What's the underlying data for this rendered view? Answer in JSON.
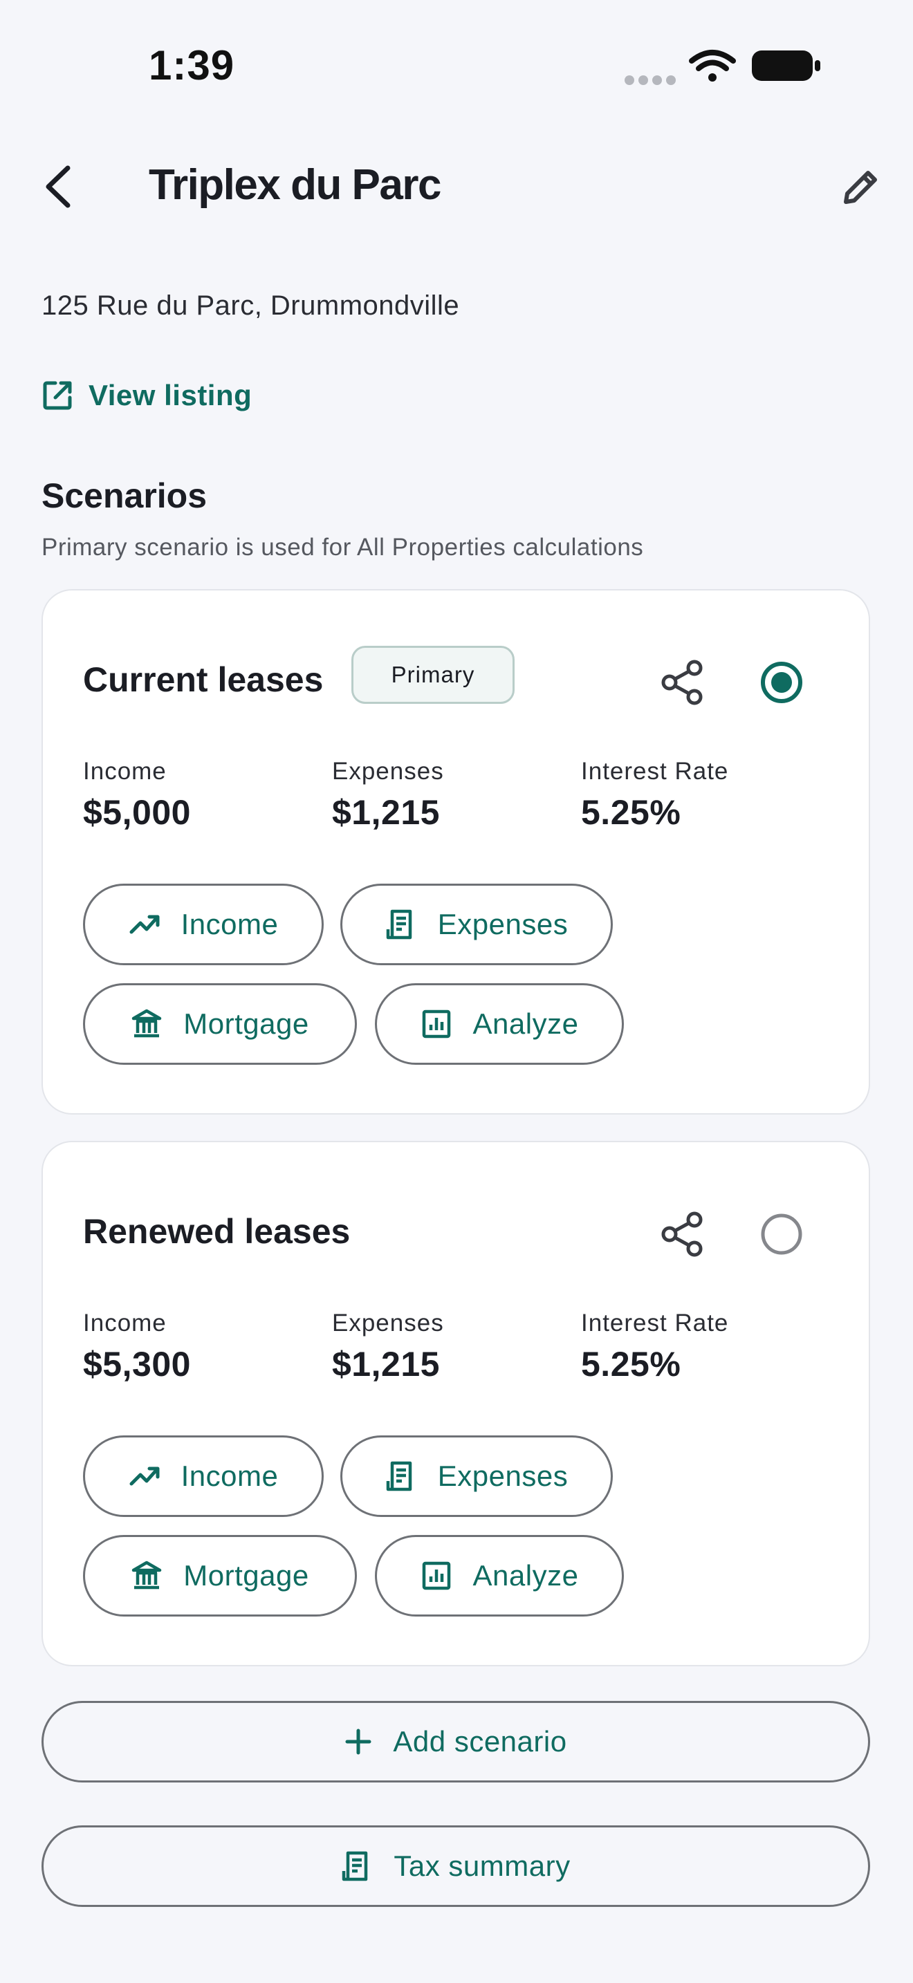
{
  "status_bar": {
    "time": "1:39",
    "icons": [
      "signal-dots-icon",
      "wifi-icon",
      "battery-icon"
    ]
  },
  "header": {
    "title": "Triplex du Parc",
    "back_icon": "chevron-left-icon",
    "edit_icon": "pencil-icon"
  },
  "property": {
    "address": "125 Rue du Parc, Drummondville",
    "view_listing_label": "View listing"
  },
  "scenarios_section": {
    "title": "Scenarios",
    "subtitle": "Primary scenario is used for All Properties calculations"
  },
  "scenarios": [
    {
      "name": "Current leases",
      "badge": "Primary",
      "selected": true,
      "metrics": [
        {
          "label": "Income",
          "value": "$5,000"
        },
        {
          "label": "Expenses",
          "value": "$1,215"
        },
        {
          "label": "Interest Rate",
          "value": "5.25%"
        }
      ],
      "actions": [
        {
          "label": "Income",
          "icon": "trending-up-icon"
        },
        {
          "label": "Expenses",
          "icon": "receipt-icon"
        },
        {
          "label": "Mortgage",
          "icon": "bank-icon"
        },
        {
          "label": "Analyze",
          "icon": "bar-chart-icon"
        }
      ]
    },
    {
      "name": "Renewed leases",
      "selected": false,
      "metrics": [
        {
          "label": "Income",
          "value": "$5,300"
        },
        {
          "label": "Expenses",
          "value": "$1,215"
        },
        {
          "label": "Interest Rate",
          "value": "5.25%"
        }
      ],
      "actions": [
        {
          "label": "Income",
          "icon": "trending-up-icon"
        },
        {
          "label": "Expenses",
          "icon": "receipt-icon"
        },
        {
          "label": "Mortgage",
          "icon": "bank-icon"
        },
        {
          "label": "Analyze",
          "icon": "bar-chart-icon"
        }
      ]
    }
  ],
  "buttons": {
    "add_scenario": "Add scenario",
    "tax_summary": "Tax summary"
  },
  "colors": {
    "accent": "#0f6b60",
    "background": "#f5f6fa",
    "card": "#ffffff",
    "text": "#1b1d24"
  }
}
